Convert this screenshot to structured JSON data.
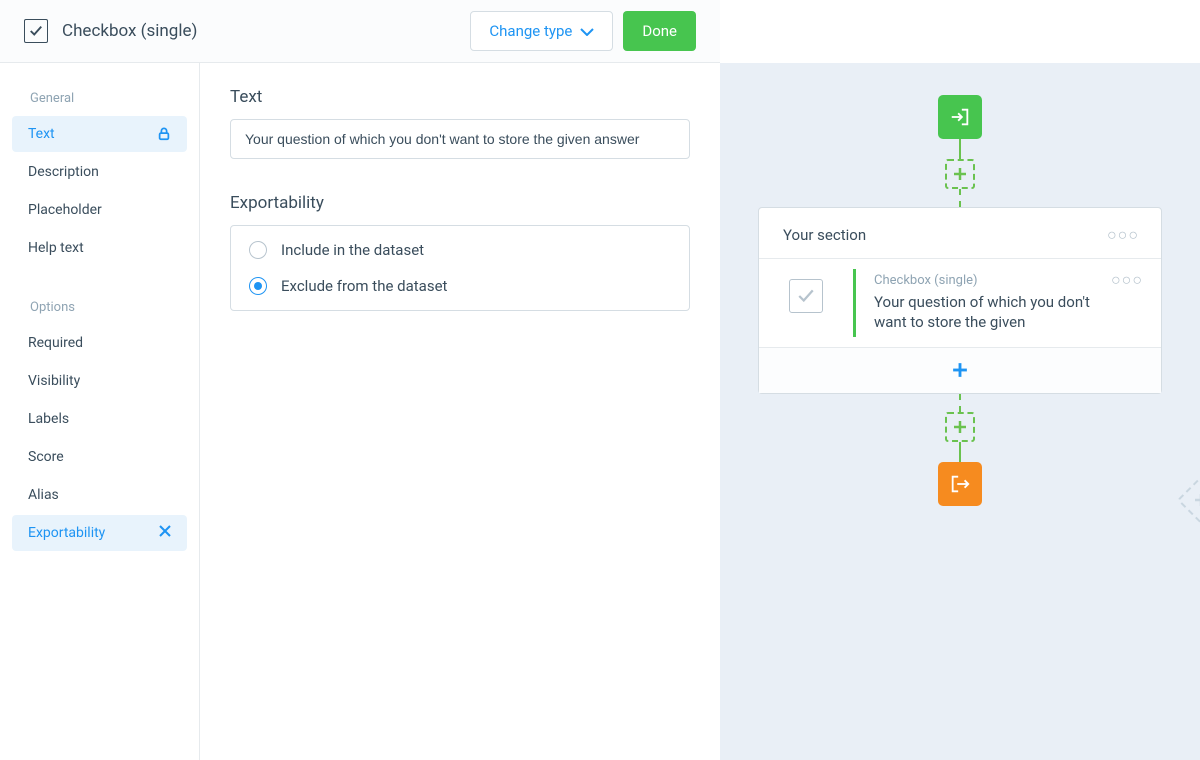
{
  "header": {
    "title": "Checkbox (single)",
    "change_type_label": "Change type",
    "done_label": "Done"
  },
  "sidebar": {
    "groups": [
      {
        "title": "General",
        "items": [
          {
            "label": "Text",
            "active": true,
            "icon": "lock"
          },
          {
            "label": "Description"
          },
          {
            "label": "Placeholder"
          },
          {
            "label": "Help text"
          }
        ]
      },
      {
        "title": "Options",
        "items": [
          {
            "label": "Required"
          },
          {
            "label": "Visibility"
          },
          {
            "label": "Labels"
          },
          {
            "label": "Score"
          },
          {
            "label": "Alias"
          },
          {
            "label": "Exportability",
            "active": true,
            "icon": "close"
          }
        ]
      }
    ]
  },
  "main": {
    "text_section_label": "Text",
    "question_value": "Your question of which you don't want to store the given answer",
    "exportability_section_label": "Exportability",
    "radio_options": [
      {
        "label": "Include in the dataset",
        "selected": false
      },
      {
        "label": "Exclude from the dataset",
        "selected": true
      }
    ]
  },
  "preview": {
    "section_title": "Your section",
    "question_type": "Checkbox (single)",
    "question_text": "Your question of which you don't want to store the given"
  },
  "colors": {
    "accent_blue": "#1e94f3",
    "accent_green": "#47c54f",
    "accent_orange": "#f68b1f"
  }
}
